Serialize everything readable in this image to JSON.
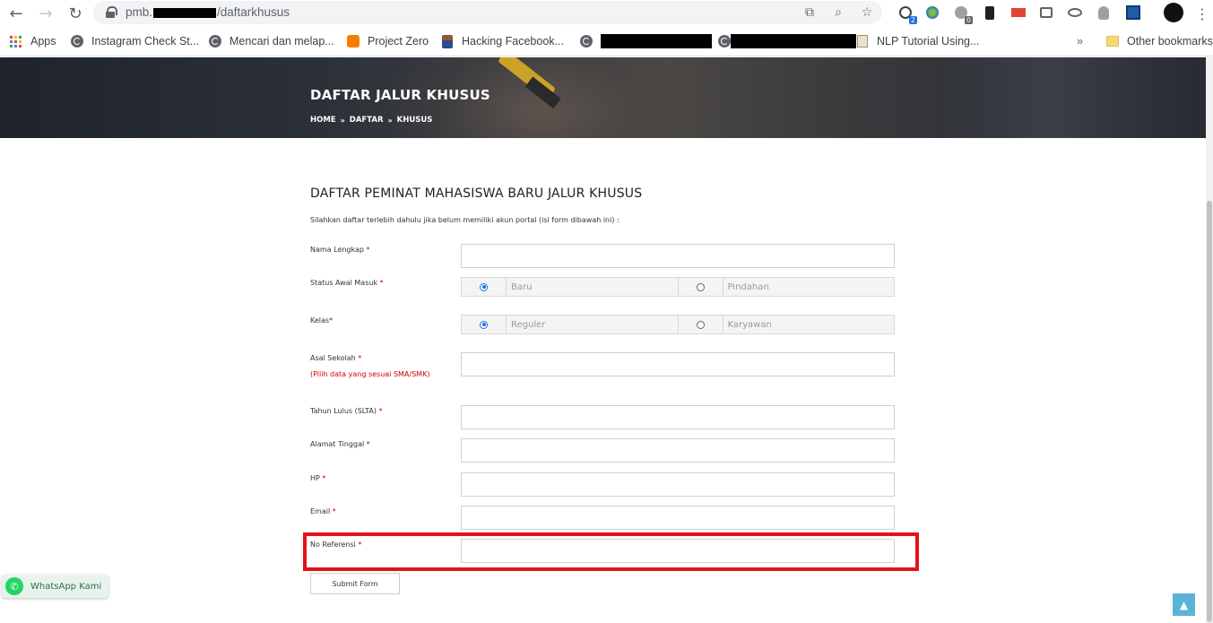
{
  "browser": {
    "url_host": "pmb.",
    "url_path": "/daftarkhusus",
    "bookmarks": [
      {
        "label": "Apps",
        "icon": "apps-grid-icon"
      },
      {
        "label": "Instagram Check St...",
        "icon": "globe-icon"
      },
      {
        "label": "Mencari dan melap...",
        "icon": "globe-icon"
      },
      {
        "label": "Project Zero",
        "icon": "blogger-icon"
      },
      {
        "label": "Hacking Facebook...",
        "icon": "avatar-icon"
      },
      {
        "label": "",
        "icon": "globe-icon"
      },
      {
        "label": "",
        "icon": "globe-icon"
      },
      {
        "label": "NLP Tutorial Using...",
        "icon": "notebook-icon"
      }
    ],
    "more_bookmarks": "»",
    "other_bookmarks": "Other bookmarks",
    "ext_badges": {
      "ext1": "2",
      "ext2": "0"
    }
  },
  "hero": {
    "title": "DAFTAR JALUR KHUSUS",
    "breadcrumb": [
      "HOME",
      "DAFTAR",
      "KHUSUS"
    ],
    "breadcrumb_sep": "»"
  },
  "form": {
    "title": "DAFTAR PEMINAT MAHASISWA BARU JALUR KHUSUS",
    "subtitle": "Silahkan daftar terlebih dahulu jika belum memiliki akun portal (isi form dibawah ini) :",
    "fields": {
      "nama": {
        "label": "Nama Lengkap",
        "required": "*",
        "value": ""
      },
      "status": {
        "label": "Status Awal Masuk",
        "required": "*",
        "options": [
          "Baru",
          "Pindahan"
        ],
        "selected": "Baru"
      },
      "kelas": {
        "label": "Kelas",
        "required": "*",
        "options": [
          "Reguler",
          "Karyawan"
        ],
        "selected": "Reguler"
      },
      "asal": {
        "label": "Asal Sekolah",
        "required": "*",
        "hint": "(Pilih data yang sesuai SMA/SMK)",
        "value": ""
      },
      "tahun": {
        "label": "Tahun Lulus (SLTA)",
        "required": "*",
        "value": ""
      },
      "alamat": {
        "label": "Alamat Tinggal",
        "required": "*",
        "value": ""
      },
      "hp": {
        "label": "HP",
        "required": "*",
        "value": ""
      },
      "email": {
        "label": "Email",
        "required": "*",
        "value": ""
      },
      "referensi": {
        "label": "No Referensi",
        "required": "*",
        "value": ""
      }
    },
    "submit_label": "Submit Form"
  },
  "widgets": {
    "whatsapp_label": "WhatsApp Kami",
    "to_top": "▲"
  },
  "colors": {
    "highlight": "#e3121b",
    "required": "#d00000",
    "radio_checked": "#1a73e8",
    "whatsapp": "#25d366",
    "to_top": "#5bb3d8"
  }
}
